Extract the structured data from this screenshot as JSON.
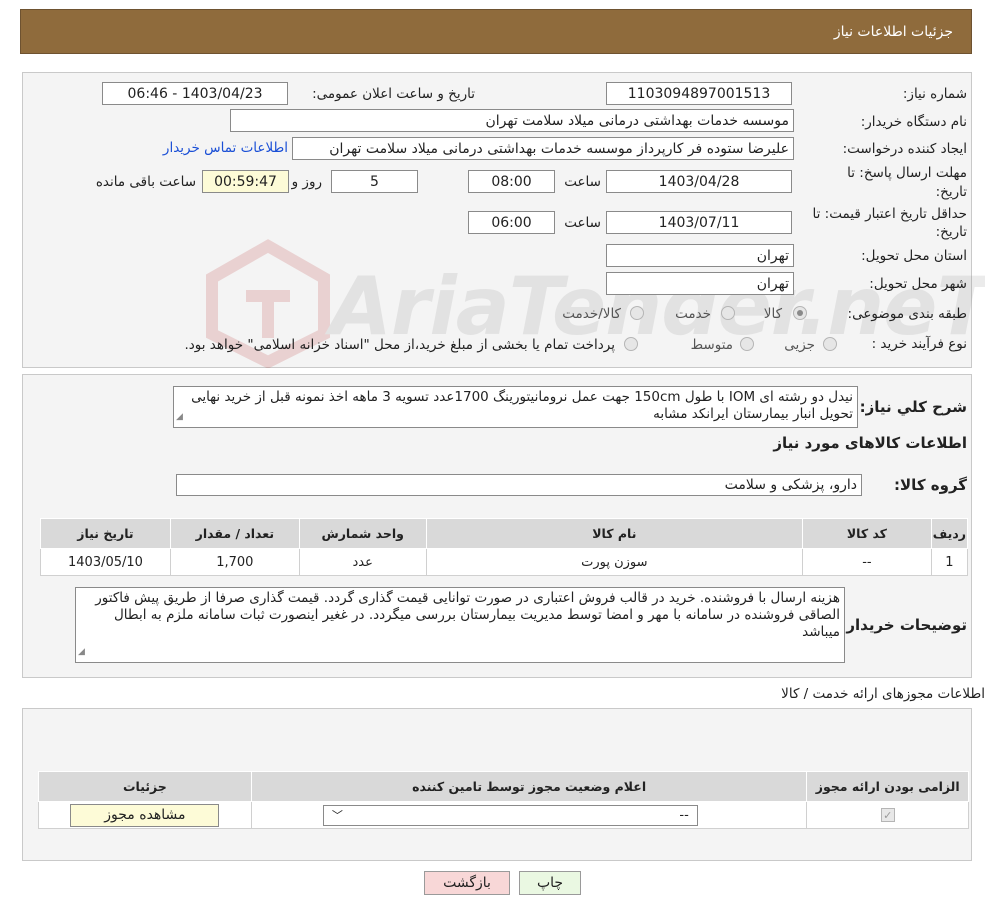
{
  "header": {
    "title": "جزئیات اطلاعات نیاز"
  },
  "watermark": {
    "text": "AriaTender.neT"
  },
  "info": {
    "need_number_label": "شماره نیاز:",
    "need_number": "1103094897001513",
    "announce_label": "تاریخ و ساعت اعلان عمومی:",
    "announce_value": "1403/04/23 - 06:46",
    "buyer_label": "نام دستگاه خریدار:",
    "buyer_value": "موسسه خدمات بهداشتی درمانی میلاد سلامت تهران",
    "creator_label": "ایجاد کننده درخواست:",
    "creator_value": "علیرضا ستوده فر کارپرداز موسسه خدمات بهداشتی درمانی میلاد سلامت تهران",
    "contact_link": "اطلاعات تماس خریدار",
    "deadline_label_1": "مهلت ارسال پاسخ: تا",
    "deadline_label_2": "تاریخ:",
    "deadline_date": "1403/04/28",
    "time_label": "ساعت",
    "deadline_time": "08:00",
    "days_value": "5",
    "days_label": "روز و",
    "remaining_time": "00:59:47",
    "remaining_label": "ساعت باقی مانده",
    "validity_label_1": "حداقل تاریخ اعتبار قیمت: تا",
    "validity_label_2": "تاریخ:",
    "validity_date": "1403/07/11",
    "validity_time": "06:00",
    "province_label": "استان محل تحویل:",
    "province_value": "تهران",
    "city_label": "شهر محل تحویل:",
    "city_value": "تهران",
    "category_label": "طبقه بندی موضوعی:",
    "category_options": [
      "کالا",
      "خدمت",
      "کالا/خدمت"
    ],
    "process_label": "نوع فرآیند خرید :",
    "process_options": [
      "جزیی",
      "متوسط"
    ],
    "process_note": "پرداخت تمام یا بخشی از مبلغ خرید،از محل \"اسناد خزانه اسلامی\" خواهد بود."
  },
  "description": {
    "label": "شرح کلي نياز:",
    "text": "نیدل دو رشته ای IOM  با طول 150cm جهت عمل نرومانیتورینگ  1700عدد تسویه 3 ماهه اخذ نمونه قبل از خرید نهایی تحویل انبار بیمارستان ایرانکد مشابه",
    "goods_title": "اطلاعات کالاهای مورد نیاز",
    "group_label": "گروه کالا:",
    "group_value": "دارو، پزشکی و سلامت"
  },
  "goods_table": {
    "headers": [
      "ردیف",
      "کد کالا",
      "نام کالا",
      "واحد شمارش",
      "تعداد / مقدار",
      "تاریخ نیاز"
    ],
    "rows": [
      [
        "1",
        "--",
        "سوزن پورت",
        "عدد",
        "1,700",
        "1403/05/10"
      ]
    ]
  },
  "buyer_notes": {
    "label": "توضیحات خریدار:",
    "text": "هزینه ارسال با فروشنده. خرید در قالب فروش اعتباری در صورت توانایی قیمت گذاری گردد. قیمت گذاری صرفا از طریق پیش فاکتور الصاقی فروشنده در سامانه با مهر و امضا توسط مدیریت بیمارستان بررسی میگردد. در غغیر اینصورت ثبات سامانه ملزم به ابطال میباشد"
  },
  "permits": {
    "title": "اطلاعات مجوزهای ارائه خدمت / کالا",
    "headers": [
      "الزامی بودن ارائه مجوز",
      "اعلام وضعیت مجوز توسط تامین کننده",
      "جزئیات"
    ],
    "select_value": "--",
    "view_button": "مشاهده مجوز"
  },
  "buttons": {
    "print": "چاپ",
    "back": "بازگشت"
  },
  "colors": {
    "header_bg": "#8f6b3c",
    "link": "#1a4fd6",
    "back_btn": "#f8d7d7",
    "print_btn": "#eaf8e2"
  }
}
